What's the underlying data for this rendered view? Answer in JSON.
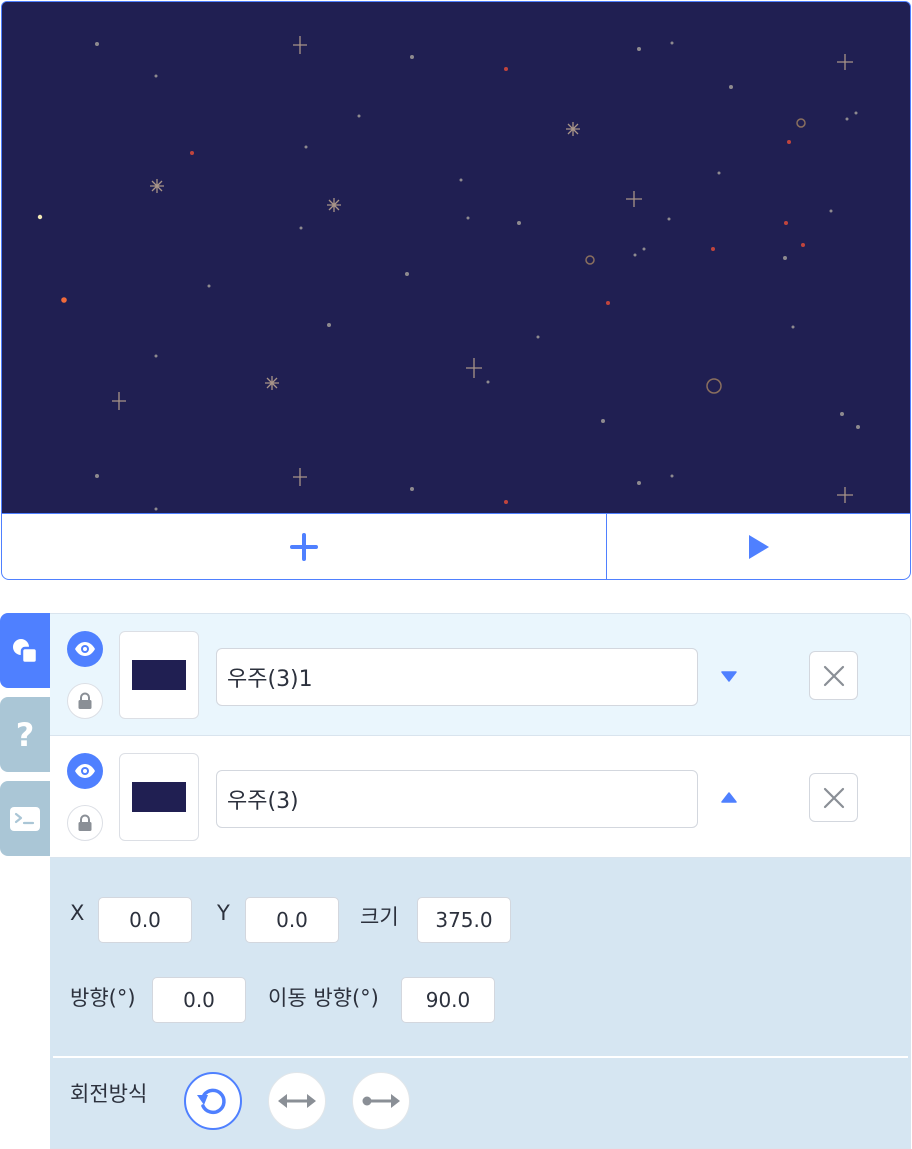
{
  "stage": {
    "background_color": "#201f52",
    "add_button_icon": "plus-icon",
    "run_button_icon": "play-icon"
  },
  "side_tabs": [
    {
      "name": "objects",
      "icon": "shapes-icon",
      "active": true
    },
    {
      "name": "help",
      "icon": "question-icon",
      "active": false
    },
    {
      "name": "console",
      "icon": "terminal-icon",
      "active": false
    }
  ],
  "objects": [
    {
      "name": "우주(3)1",
      "selected": true,
      "visible": true,
      "locked": false,
      "order_icon": "triangle-down-icon"
    },
    {
      "name": "우주(3)",
      "selected": false,
      "visible": true,
      "locked": false,
      "order_icon": "triangle-up-icon"
    }
  ],
  "properties": {
    "x_label": "X",
    "x_value": "0.0",
    "y_label": "Y",
    "y_value": "0.0",
    "size_label": "크기",
    "size_value": "375.0",
    "direction_label": "방향(°)",
    "direction_value": "0.0",
    "move_direction_label": "이동 방향(°)",
    "move_direction_value": "90.0",
    "rotation_label": "회전방식",
    "rotation_modes": [
      "rotate-free-icon",
      "flip-horizontal-icon",
      "no-rotate-icon"
    ],
    "rotation_active_index": 0
  },
  "colors": {
    "accent": "#4f80ff",
    "panel_bg": "#d6e6f2",
    "selected_row_bg": "#eaf6fd",
    "tab_inactive": "#aac6d6"
  }
}
